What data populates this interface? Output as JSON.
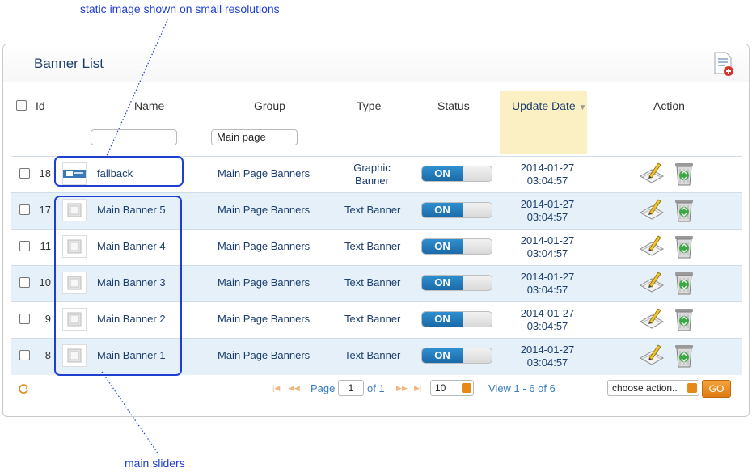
{
  "annotations": {
    "top": "static image shown on small resolutions",
    "bottom": "main sliders"
  },
  "panel": {
    "title": "Banner List"
  },
  "columns": {
    "id": "Id",
    "name": "Name",
    "group": "Group",
    "type": "Type",
    "status": "Status",
    "update_date": "Update Date",
    "action": "Action"
  },
  "filters": {
    "name_value": "",
    "group_value": "Main page"
  },
  "rows": [
    {
      "id": "18",
      "name": "fallback",
      "group": "Main Page Banners",
      "type_line1": "Graphic",
      "type_line2": "Banner",
      "status": "ON",
      "date": "2014-01-27",
      "time": "03:04:57"
    },
    {
      "id": "17",
      "name": "Main Banner 5",
      "group": "Main Page Banners",
      "type_line1": "Text Banner",
      "type_line2": "",
      "status": "ON",
      "date": "2014-01-27",
      "time": "03:04:57"
    },
    {
      "id": "11",
      "name": "Main Banner 4",
      "group": "Main Page Banners",
      "type_line1": "Text Banner",
      "type_line2": "",
      "status": "ON",
      "date": "2014-01-27",
      "time": "03:04:57"
    },
    {
      "id": "10",
      "name": "Main Banner 3",
      "group": "Main Page Banners",
      "type_line1": "Text Banner",
      "type_line2": "",
      "status": "ON",
      "date": "2014-01-27",
      "time": "03:04:57"
    },
    {
      "id": "9",
      "name": "Main Banner 2",
      "group": "Main Page Banners",
      "type_line1": "Text Banner",
      "type_line2": "",
      "status": "ON",
      "date": "2014-01-27",
      "time": "03:04:57"
    },
    {
      "id": "8",
      "name": "Main Banner 1",
      "group": "Main Page Banners",
      "type_line1": "Text Banner",
      "type_line2": "",
      "status": "ON",
      "date": "2014-01-27",
      "time": "03:04:57"
    }
  ],
  "pager": {
    "page_label": "Page",
    "page_value": "1",
    "of_label": "of 1",
    "page_size": "10",
    "view_text": "View 1 - 6 of 6"
  },
  "bulk": {
    "placeholder": "choose action..",
    "go_label": "GO"
  },
  "colors": {
    "accent": "#1f3fd1",
    "toggle_on": "#1b6aa8",
    "highlight": "#fbf0c3",
    "go": "#de7a12"
  }
}
